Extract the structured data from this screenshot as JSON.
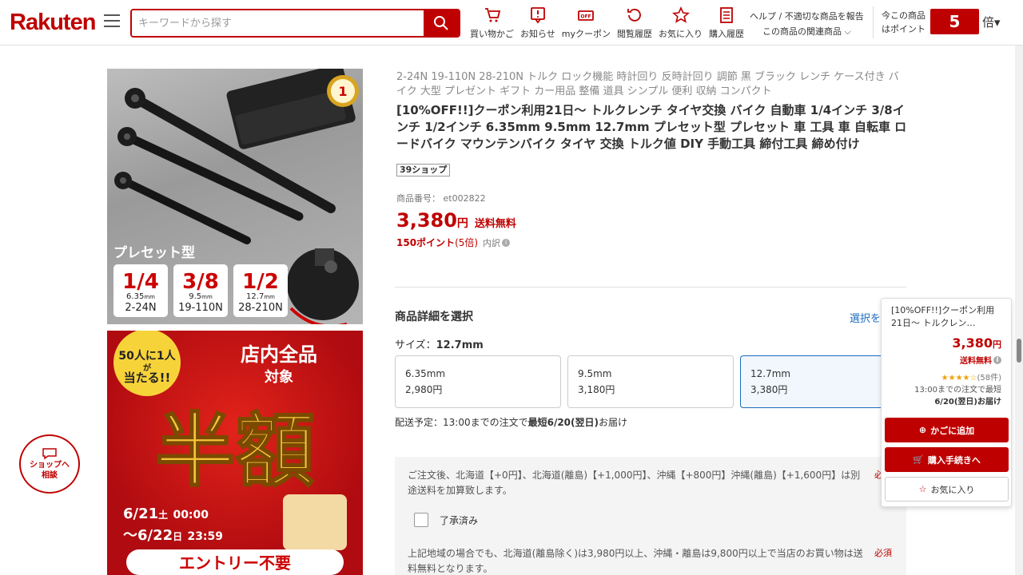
{
  "header": {
    "logo": "Rakuten",
    "search_placeholder": "キーワードから探す",
    "nav": [
      {
        "label": "買い物かご",
        "icon": "cart-icon"
      },
      {
        "label": "お知らせ",
        "icon": "notification-icon"
      },
      {
        "label": "myクーポン",
        "icon": "coupon-icon"
      },
      {
        "label": "閲覧履歴",
        "icon": "history-icon"
      },
      {
        "label": "お気に入り",
        "icon": "star-icon"
      },
      {
        "label": "購入履歴",
        "icon": "receipt-icon"
      }
    ],
    "help_line1": "ヘルプ / 不適切な商品を報告",
    "help_line2": "この商品の関連商品",
    "point_label1": "今この商品",
    "point_label2": "はポイント",
    "point_multiplier": "5",
    "point_suffix": "倍"
  },
  "images": {
    "preset_label": "プレセット型",
    "sizes": [
      {
        "inch": "1/4",
        "mm": "6.35",
        "unit": "mm",
        "range": "2-24N"
      },
      {
        "inch": "3/8",
        "mm": "9.5",
        "unit": "mm",
        "range": "19-110N"
      },
      {
        "inch": "1/2",
        "mm": "12.7",
        "unit": "mm",
        "range": "28-210N"
      }
    ],
    "badge_number": "1",
    "banner_top": "50人に1人",
    "banner_ga": "が",
    "banner_win": "当たる!!",
    "banner_store1": "店内全品",
    "banner_store2": "対象",
    "banner_main": "半額",
    "banner_date1": "6/21",
    "banner_day1": "土",
    "banner_time1": "00:00",
    "banner_date2": "〜6/22",
    "banner_day2": "日",
    "banner_time2": "23:59",
    "banner_entry": "エントリー不要"
  },
  "product": {
    "tagline": "2-24N 19-110N 28-210N トルク ロック機能 時計回り 反時計回り 調節 黒 ブラック レンチ ケース付き バイク 大型 プレゼント ギフト カー用品 整備 道具 シンプル 便利 収納 コンパクト",
    "title": "[10%OFF!!]クーポン利用21日〜 トルクレンチ タイヤ交換 バイク 自動車 1/4インチ 3/8インチ 1/2インチ 6.35mm 9.5mm 12.7mm プレセット型 プレセット 車 工具 車 自転車 ロードバイク マウンテンバイク タイヤ 交換 トルク値 DIY 手動工具 締付工具 締め付け",
    "shop": "39ショップ",
    "product_no_label": "商品番号：",
    "product_no": "et002822",
    "price": "3,380",
    "yen": "円",
    "free_shipping": "送料無料",
    "points": "150ポイント",
    "points_rate": "(5倍)",
    "breakdown": "内訳"
  },
  "selection": {
    "title": "商品詳細を選択",
    "link": "選択を",
    "size_label": "サイズ：",
    "size_value": "12.7mm",
    "options": [
      {
        "name": "6.35mm",
        "price": "2,980円"
      },
      {
        "name": "9.5mm",
        "price": "3,180円"
      },
      {
        "name": "12.7mm",
        "price": "3,380円"
      }
    ],
    "delivery_prefix": "配送予定：13:00までの注文で",
    "delivery_bold": "最短6/20(翌日)",
    "delivery_suffix": "お届け"
  },
  "notice": {
    "text1": "ご注文後、北海道【+0円】、北海道(離島)【+1,000円】、沖縄【+800円】沖縄(離島)【+1,600円】は別途送料を加算致します。",
    "req": "必",
    "checkbox_label": "了承済み",
    "text2": "上記地域の場合でも、北海道(離島除く)は3,980円以上、沖縄・離島は9,800円以上で当店のお買い物は送料無料となります。",
    "req2": "必須"
  },
  "float_panel": {
    "title": "[10%OFF!!]クーポン利用21日〜 トルクレン…",
    "price": "3,380",
    "yen": "円",
    "free": "送料無料",
    "stars": "★★★★☆",
    "rating_count": "(58件)",
    "deliv_line1": "13:00までの注文で最短",
    "deliv_line2": "6/20(翌日)お届け",
    "cart_btn": "かごに追加",
    "buy_btn": "購入手続きへ",
    "fav_btn": "お気に入り"
  },
  "chat": {
    "line1": "ショップへ",
    "line2": "相談"
  },
  "colors": {
    "brand": "#bf0000",
    "link": "#1a6cbf"
  }
}
